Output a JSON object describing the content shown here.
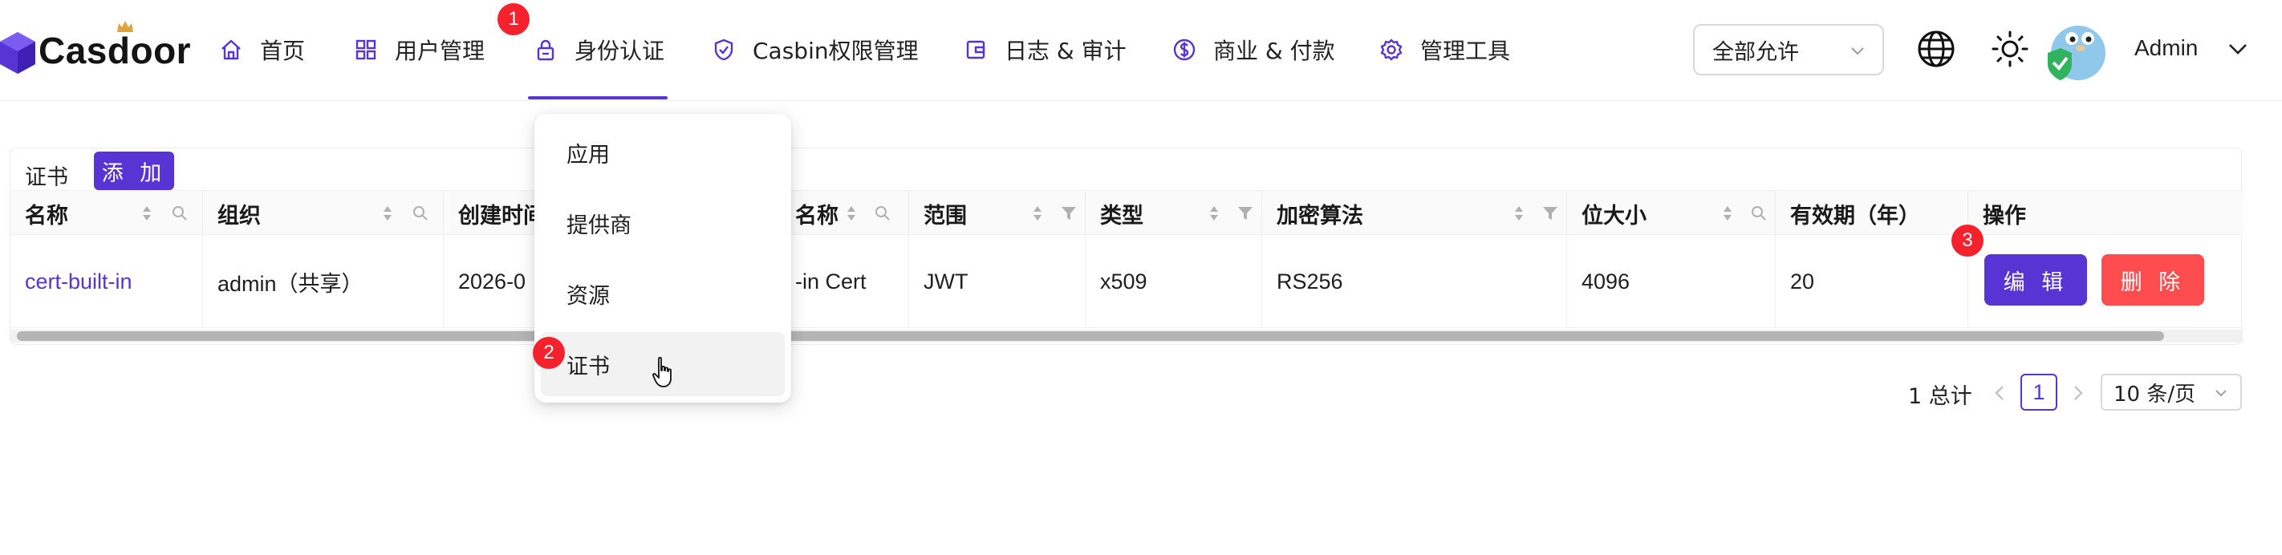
{
  "app": {
    "logo_text": "Casdoor",
    "brand_color": "#5734d3"
  },
  "nav": {
    "items": [
      {
        "label": "首页",
        "icon": "home-icon"
      },
      {
        "label": "用户管理",
        "icon": "grid-icon"
      },
      {
        "label": "身份认证",
        "icon": "lock-icon",
        "active": true
      },
      {
        "label": "Casbin权限管理",
        "icon": "shield-check-icon"
      },
      {
        "label": "日志 & 审计",
        "icon": "wallet-icon"
      },
      {
        "label": "商业 & 付款",
        "icon": "dollar-icon"
      },
      {
        "label": "管理工具",
        "icon": "gear-icon"
      }
    ],
    "org_select": "全部允许",
    "username": "Admin"
  },
  "annotations": {
    "step1": "1",
    "step2": "2",
    "step3": "3"
  },
  "dropdown": {
    "items": [
      "应用",
      "提供商",
      "资源",
      "证书"
    ],
    "hovered": "证书"
  },
  "table": {
    "title": "证书",
    "add_label": "添 加",
    "columns": [
      "名称",
      "组织",
      "创建时间",
      "名称",
      "范围",
      "类型",
      "加密算法",
      "位大小",
      "有效期（年）",
      "操作"
    ],
    "rows": [
      {
        "name": "cert-built-in",
        "organization": "admin（共享）",
        "created": "2026-0",
        "display_name": "-in Cert",
        "scope": "JWT",
        "type": "x509",
        "algorithm": "RS256",
        "bit_size": "4096",
        "expire_years": "20"
      }
    ],
    "edit_label": "编 辑",
    "delete_label": "删 除"
  },
  "pagination": {
    "total": "1 总计",
    "current": "1",
    "page_size": "10 条/页"
  }
}
